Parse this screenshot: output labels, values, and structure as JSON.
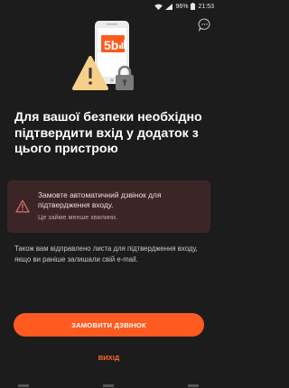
{
  "status_bar": {
    "battery": "96%",
    "time": "21:53"
  },
  "icons": {
    "chat": "chat-bubble-icon",
    "hero": "phone-warning-lock-illustration",
    "alert": "warning-triangle-icon"
  },
  "colors": {
    "background": "#1c1c1c",
    "accent": "#ff5a1f",
    "alert_bg": "#3c2526",
    "alert_icon": "#d26e6e"
  },
  "main": {
    "headline": "Для вашої безпеки необхідно підтвердити вхід у додаток з цього пристрою",
    "alert": {
      "message": "Замовте автоматичний дзвінок для підтвердження входу.",
      "sub": "Це займе менше хвилини."
    },
    "info": "Також вам відправлено листа для підтвердження входу, якщо ви раніше залишали свій e-mail."
  },
  "actions": {
    "primary_label": "ЗАМОВИТИ ДЗВІНОК",
    "secondary_label": "ВИХІД"
  }
}
